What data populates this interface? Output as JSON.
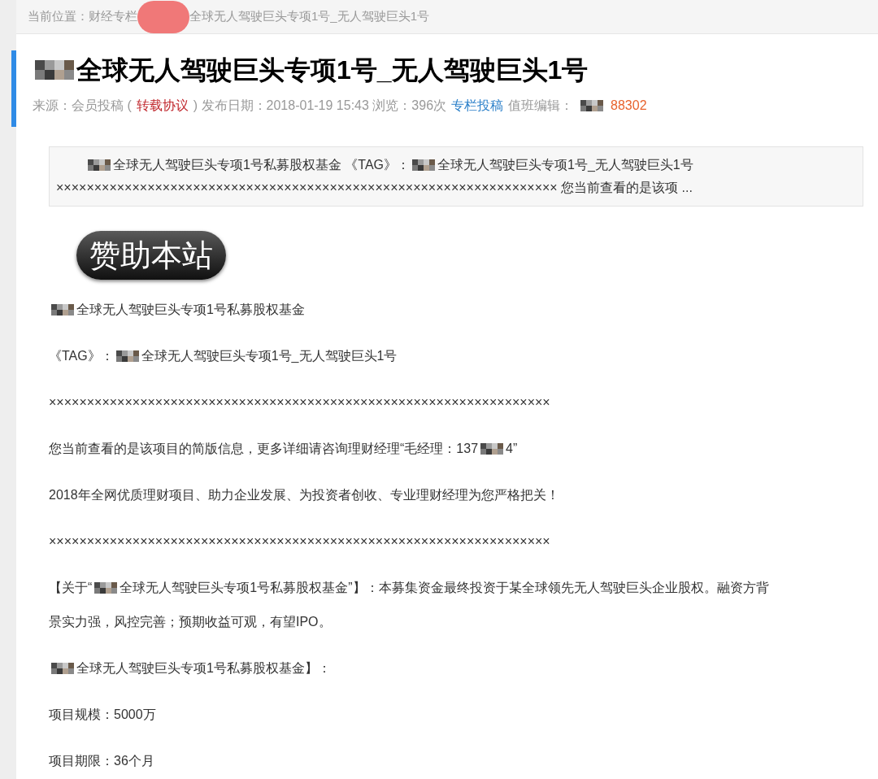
{
  "breadcrumb": [
    {
      "kind": "text",
      "text": "当前位置：财经专栏"
    },
    {
      "kind": "blot"
    },
    {
      "kind": "text",
      "text": "全球无人驾驶巨头专项1号_无人驾驶巨头1号"
    }
  ],
  "title": [
    {
      "kind": "mosaic"
    },
    {
      "kind": "text",
      "text": "全球无人驾驶巨头专项1号_无人驾驶巨头1号"
    }
  ],
  "meta": [
    {
      "kind": "text",
      "color": "#999999",
      "text": "来源：会员投稿 ("
    },
    {
      "kind": "text",
      "color": "#c0272d",
      "text": "转载协议"
    },
    {
      "kind": "text",
      "color": "#999999",
      "text": ") 发布日期：2018-01-19 15:43 浏览：396次"
    },
    {
      "kind": "text",
      "color": "#2a7fc9",
      "text": "专栏投稿"
    },
    {
      "kind": "text",
      "color": "#999999",
      "text": "值班编辑："
    },
    {
      "kind": "mosaic"
    },
    {
      "kind": "text",
      "color": "#e8632e",
      "text": "88302"
    }
  ],
  "summary": [
    [
      {
        "kind": "mosaic"
      },
      {
        "kind": "text",
        "text": "全球无人驾驶巨头专项1号私募股权基金 《TAG》："
      },
      {
        "kind": "mosaic"
      },
      {
        "kind": "text",
        "text": "全球无人驾驶巨头专项1号_无人驾驶巨头1号"
      }
    ],
    [
      {
        "kind": "text",
        "text": "×××××××××××××××××××××××××××××××××××××××××××××××××××××××××××××××××× 您当前查看的是该项 ..."
      }
    ]
  ],
  "sponsor_button": "赞助本站",
  "paragraphs": [
    [
      [
        {
          "kind": "mosaic"
        },
        {
          "kind": "text",
          "text": "全球无人驾驶巨头专项1号私募股权基金"
        }
      ]
    ],
    [
      [
        {
          "kind": "text",
          "text": "《TAG》："
        },
        {
          "kind": "mosaic"
        },
        {
          "kind": "text",
          "text": "全球无人驾驶巨头专项1号_无人驾驶巨头1号"
        }
      ]
    ],
    [
      [
        {
          "kind": "text",
          "text": "××××××××××××××××××××××××××××××××××××××××××××××××××××××××××××××××××"
        }
      ]
    ],
    [
      [
        {
          "kind": "text",
          "text": "您当前查看的是该项目的简版信息，更多详细请咨询理财经理“毛经理：137"
        },
        {
          "kind": "mosaic"
        },
        {
          "kind": "text",
          "text": "4”"
        }
      ]
    ],
    [
      [
        {
          "kind": "text",
          "text": "2018年全网优质理财项目、助力企业发展、为投资者创收、专业理财经理为您严格把关！"
        }
      ]
    ],
    [
      [
        {
          "kind": "text",
          "text": "××××××××××××××××××××××××××××××××××××××××××××××××××××××××××××××××××"
        }
      ]
    ],
    [
      [
        {
          "kind": "text",
          "text": "【关于“"
        },
        {
          "kind": "mosaic"
        },
        {
          "kind": "text",
          "text": "全球无人驾驶巨头专项1号私募股权基金”】：本募集资金最终投资于某全球领先无人驾驶巨头企业股权。融资方背"
        }
      ],
      [
        {
          "kind": "text",
          "text": "景实力强，风控完善；预期收益可观，有望IPO。"
        }
      ]
    ],
    [
      [
        {
          "kind": "mosaic"
        },
        {
          "kind": "text",
          "text": "全球无人驾驶巨头专项1号私募股权基金】："
        }
      ]
    ],
    [
      [
        {
          "kind": "text",
          "text": "项目规模：5000万"
        }
      ]
    ],
    [
      [
        {
          "kind": "text",
          "text": "项目期限：36个月"
        }
      ]
    ]
  ]
}
